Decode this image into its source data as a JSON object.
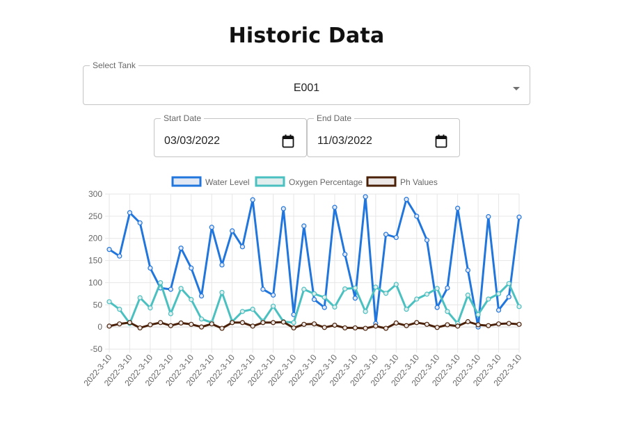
{
  "page": {
    "title": "Historic Data"
  },
  "tank_select": {
    "label": "Select Tank",
    "value": "E001"
  },
  "start_date": {
    "label": "Start Date",
    "value": "03/03/2022"
  },
  "end_date": {
    "label": "End Date",
    "value": "11/03/2022"
  },
  "icons": {
    "dropdown": "chevron-down-icon",
    "calendar": "calendar-icon"
  },
  "chart_data": {
    "type": "line",
    "title": "",
    "xlabel": "",
    "ylabel": "",
    "ylim": [
      -50,
      300
    ],
    "yticks": [
      -50,
      0,
      50,
      100,
      150,
      200,
      250,
      300
    ],
    "grid": true,
    "legend_position": "top-center",
    "x": [
      "2022-3-10",
      "2022-3-10",
      "2022-3-10",
      "2022-3-10",
      "2022-3-10",
      "2022-3-10",
      "2022-3-10",
      "2022-3-10",
      "2022-3-10",
      "2022-3-10",
      "2022-3-10",
      "2022-3-10",
      "2022-3-10",
      "2022-3-10",
      "2022-3-10",
      "2022-3-10",
      "2022-3-10",
      "2022-3-10",
      "2022-3-10",
      "2022-3-10",
      "2022-3-10",
      "2022-3-10",
      "2022-3-10",
      "2022-3-10",
      "2022-3-10",
      "2022-3-10",
      "2022-3-10",
      "2022-3-10",
      "2022-3-10",
      "2022-3-10",
      "2022-3-10",
      "2022-3-10",
      "2022-3-10",
      "2022-3-10",
      "2022-3-10",
      "2022-3-10",
      "2022-3-10",
      "2022-3-10",
      "2022-3-10",
      "2022-3-10",
      "2022-3-10",
      "2022-3-10"
    ],
    "x_tick_labels": [
      "2022-3-10",
      "2022-3-10",
      "2022-3-10",
      "2022-3-10",
      "2022-3-10",
      "2022-3-10",
      "2022-3-10",
      "2022-3-10",
      "2022-3-10",
      "2022-3-10",
      "2022-3-10",
      "2022-3-10",
      "2022-3-10",
      "2022-3-10",
      "2022-3-10",
      "2022-3-10",
      "2022-3-10",
      "2022-3-10",
      "2022-3-10",
      "2022-3-10",
      "2022-3-10"
    ],
    "series": [
      {
        "name": "Water Level",
        "color": "#2176dd",
        "fill": "#e3e9f4",
        "values": [
          175,
          160,
          258,
          235,
          133,
          88,
          85,
          178,
          133,
          70,
          225,
          140,
          217,
          181,
          287,
          85,
          72,
          267,
          28,
          228,
          62,
          44,
          270,
          164,
          65,
          294,
          8,
          209,
          202,
          288,
          250,
          196,
          44,
          88,
          268,
          128,
          0,
          249,
          38,
          68,
          248
        ]
      },
      {
        "name": "Oxygen Percentage",
        "color": "#4bc0c0",
        "fill": "#e2eded",
        "values": [
          57,
          40,
          8,
          66,
          43,
          100,
          30,
          87,
          62,
          18,
          10,
          78,
          12,
          35,
          40,
          13,
          47,
          12,
          10,
          85,
          75,
          67,
          45,
          86,
          88,
          35,
          90,
          76,
          96,
          40,
          63,
          74,
          87,
          35,
          8,
          72,
          28,
          63,
          75,
          98,
          46
        ]
      },
      {
        "name": "Ph Values",
        "color": "#4a2007",
        "fill": "#ece8e8",
        "values": [
          2,
          7,
          10,
          -2,
          5,
          10,
          3,
          9,
          6,
          0,
          7,
          -3,
          10,
          10,
          2,
          10,
          10,
          11,
          -2,
          6,
          7,
          -1,
          4,
          -2,
          -2,
          -3,
          2,
          -3,
          9,
          3,
          10,
          6,
          -1,
          5,
          2,
          12,
          5,
          3,
          7,
          8,
          6
        ]
      }
    ]
  }
}
